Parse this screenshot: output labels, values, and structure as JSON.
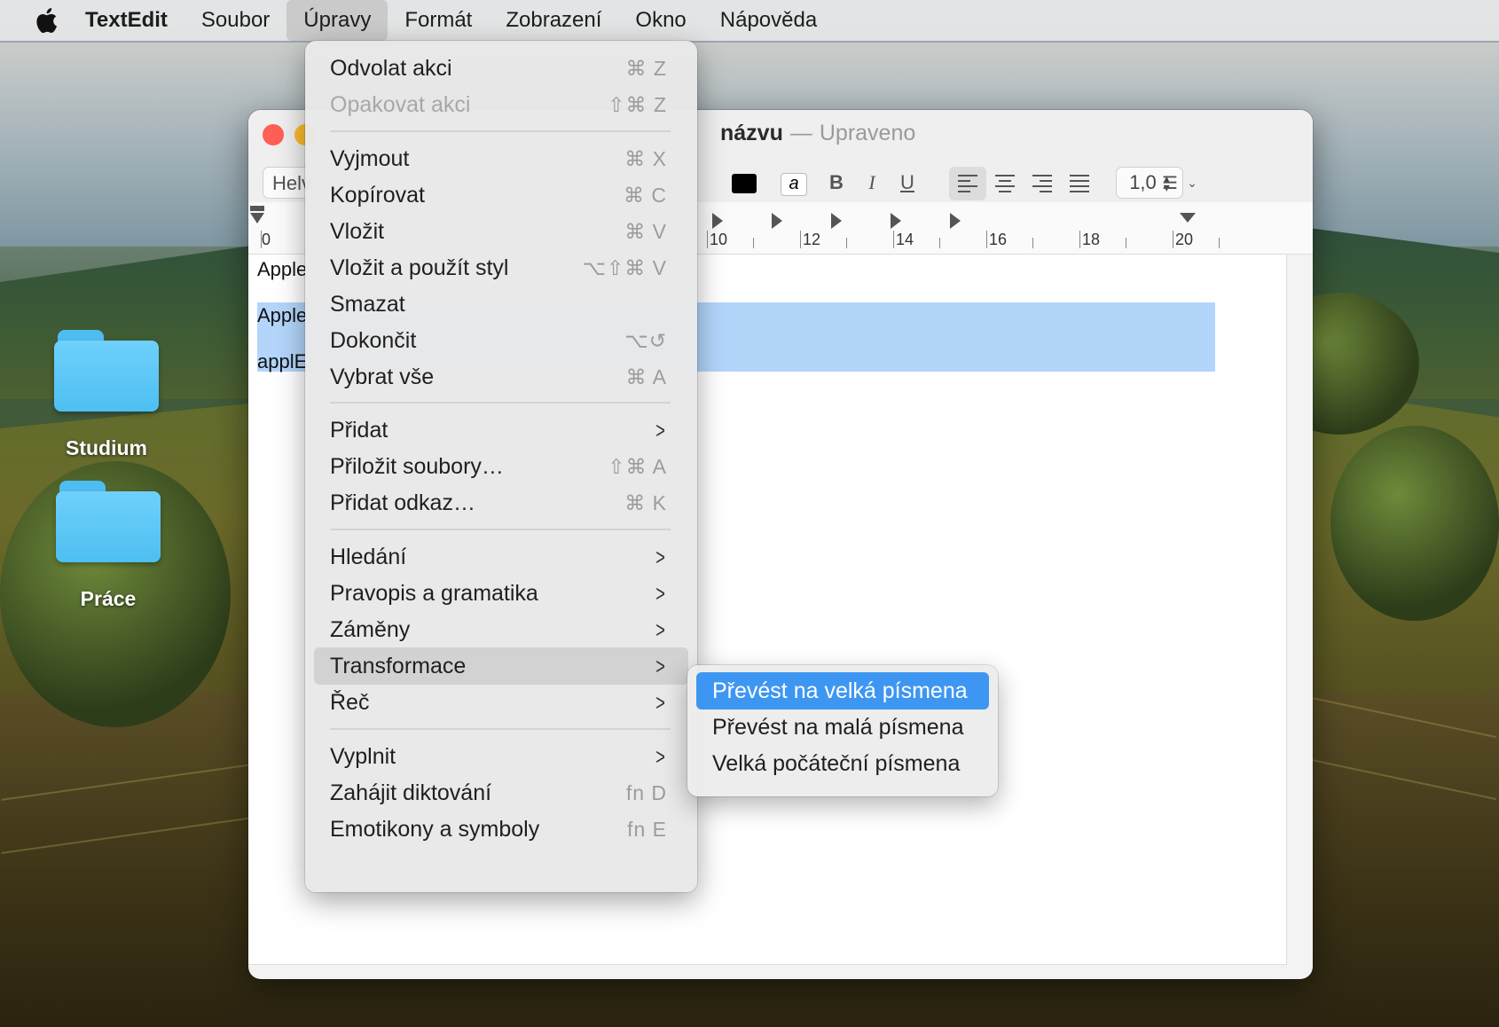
{
  "menubar": {
    "app_name": "TextEdit",
    "items": [
      "Soubor",
      "Úpravy",
      "Formát",
      "Zobrazení",
      "Okno",
      "Nápověda"
    ]
  },
  "desktop": {
    "icons": [
      {
        "label": "Studium"
      },
      {
        "label": "Práce"
      }
    ]
  },
  "window": {
    "title_prefix": "názvu",
    "title_dash": "—",
    "title_status": "Upraveno",
    "font_field": "Helv",
    "line_spacing": "1,0",
    "ruler_numbers": [
      "0",
      "10",
      "12",
      "14",
      "16",
      "18",
      "20"
    ],
    "doc_lines": [
      "Apple",
      "Apple",
      "applE"
    ],
    "format_bold": "B",
    "format_italic": "I",
    "format_underline": "U",
    "highlight_glyph": "a"
  },
  "edit_menu": {
    "items": [
      {
        "label": "Odvolat akci",
        "shortcut": "⌘ Z"
      },
      {
        "label": "Opakovat akci",
        "shortcut": "⇧⌘ Z",
        "disabled": true
      },
      {
        "label": "Vyjmout",
        "shortcut": "⌘ X"
      },
      {
        "label": "Kopírovat",
        "shortcut": "⌘ C"
      },
      {
        "label": "Vložit",
        "shortcut": "⌘ V"
      },
      {
        "label": "Vložit a použít styl",
        "shortcut": "⌥⇧⌘ V"
      },
      {
        "label": "Smazat",
        "shortcut": ""
      },
      {
        "label": "Dokončit",
        "shortcut": "⌥↺"
      },
      {
        "label": "Vybrat vše",
        "shortcut": "⌘ A"
      },
      {
        "label": "Přidat",
        "submenu": true
      },
      {
        "label": "Přiložit soubory…",
        "shortcut": "⇧⌘ A"
      },
      {
        "label": "Přidat odkaz…",
        "shortcut": "⌘ K"
      },
      {
        "label": "Hledání",
        "submenu": true
      },
      {
        "label": "Pravopis a gramatika",
        "submenu": true
      },
      {
        "label": "Záměny",
        "submenu": true
      },
      {
        "label": "Transformace",
        "submenu": true,
        "highlighted": true
      },
      {
        "label": "Řeč",
        "submenu": true
      },
      {
        "label": "Vyplnit",
        "submenu": true
      },
      {
        "label": "Zahájit diktování",
        "shortcut": "fn D"
      },
      {
        "label": "Emotikony a symboly",
        "shortcut": "fn E"
      }
    ]
  },
  "transform_submenu": {
    "items": [
      {
        "label": "Převést na velká písmena",
        "selected": true
      },
      {
        "label": "Převést na malá písmena"
      },
      {
        "label": "Velká počáteční písmena"
      }
    ]
  },
  "colors": {
    "accent": "#3d97f2",
    "selection": "#b3d5fa",
    "folder": "#5ec8f8",
    "close": "#ff5f57",
    "minimize": "#febc2e"
  }
}
